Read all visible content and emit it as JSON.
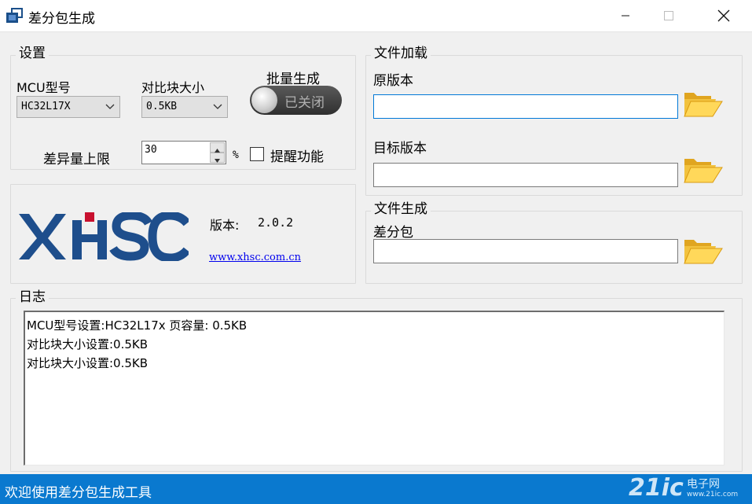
{
  "window": {
    "title": "差分包生成",
    "minimize_icon": "minimize-icon",
    "maximize_icon": "maximize-icon",
    "close_icon": "close-icon"
  },
  "settings": {
    "legend": "设置",
    "mcu_label": "MCU型号",
    "mcu_value": "HC32L17X",
    "block_label": "对比块大小",
    "block_value": "0.5KB",
    "batch_label": "批量生成",
    "batch_toggle_text": "已关闭",
    "diff_limit_label": "差异量上限",
    "diff_limit_value": "30",
    "percent_label": "%",
    "remind_label": "提醒功能",
    "remind_checked": false
  },
  "about": {
    "logo_text": "XHSC",
    "version_label": "版本:",
    "version_value": "2.0.2",
    "website": "www.xhsc.com.cn",
    "brand_color": "#1e4e8c",
    "accent_color": "#c8102e"
  },
  "file_load": {
    "legend": "文件加载",
    "original_label": "原版本",
    "original_value": "",
    "target_label": "目标版本",
    "target_value": ""
  },
  "file_gen": {
    "legend": "文件生成",
    "package_label": "差分包",
    "package_value": ""
  },
  "log": {
    "legend": "日志",
    "lines": [
      "MCU型号设置:HC32L17x 页容量: 0.5KB",
      "对比块大小设置:0.5KB",
      "对比块大小设置:0.5KB"
    ]
  },
  "status": {
    "text": "欢迎使用差分包生成工具",
    "color": "#0a79cf"
  },
  "watermark": {
    "text1": "21ic",
    "text2": "电子网",
    "text3": "www.21ic.com"
  }
}
